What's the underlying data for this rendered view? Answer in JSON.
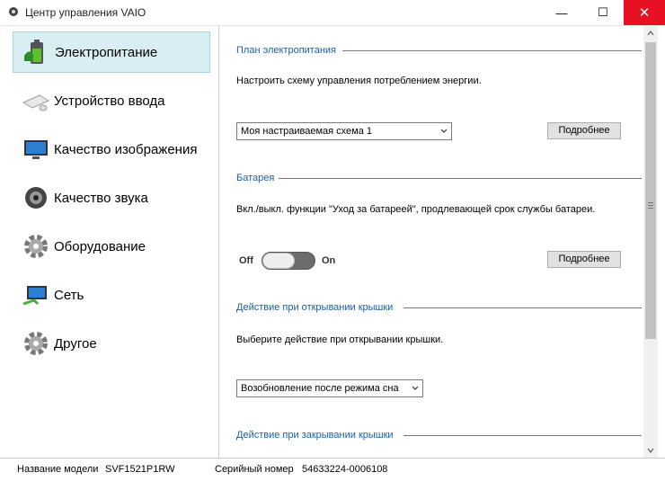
{
  "window": {
    "title": "Центр управления VAIO",
    "minimize": "—",
    "maximize": "☐",
    "close": "✕"
  },
  "sidebar": {
    "items": [
      {
        "label": "Электропитание",
        "icon": "battery-icon",
        "active": true
      },
      {
        "label": "Устройство ввода",
        "icon": "keyboard-icon"
      },
      {
        "label": "Качество изображения",
        "icon": "monitor-icon"
      },
      {
        "label": "Качество звука",
        "icon": "speaker-icon"
      },
      {
        "label": "Оборудование",
        "icon": "gear-icon"
      },
      {
        "label": "Сеть",
        "icon": "network-icon"
      },
      {
        "label": "Другое",
        "icon": "gear-icon"
      }
    ]
  },
  "power_plan": {
    "heading": "План электропитания",
    "description": "Настроить схему управления потреблением энергии.",
    "selected": "Моя настраиваемая схема 1",
    "details_button": "Подробнее"
  },
  "battery": {
    "heading": "Батарея",
    "description": "Вкл./выкл. функции \"Уход за батареей\", продлевающей срок службы батареи.",
    "off_label": "Off",
    "on_label": "On",
    "toggle_state": "off",
    "details_button": "Подробнее"
  },
  "lid_open": {
    "heading": "Действие при открывании крышки",
    "description": "Выберите действие при открывании крышки.",
    "selected": "Возобновление после режима сна"
  },
  "lid_close": {
    "heading": "Действие при закрывании крышки"
  },
  "status": {
    "model_label": "Название модели",
    "model_value": "SVF1521P1RW",
    "serial_label": "Серийный номер",
    "serial_value": "54633224-0006108"
  },
  "colors": {
    "accent": "#1a5fa8",
    "active_bg": "#d8eef3",
    "close_button": "#e81123"
  }
}
